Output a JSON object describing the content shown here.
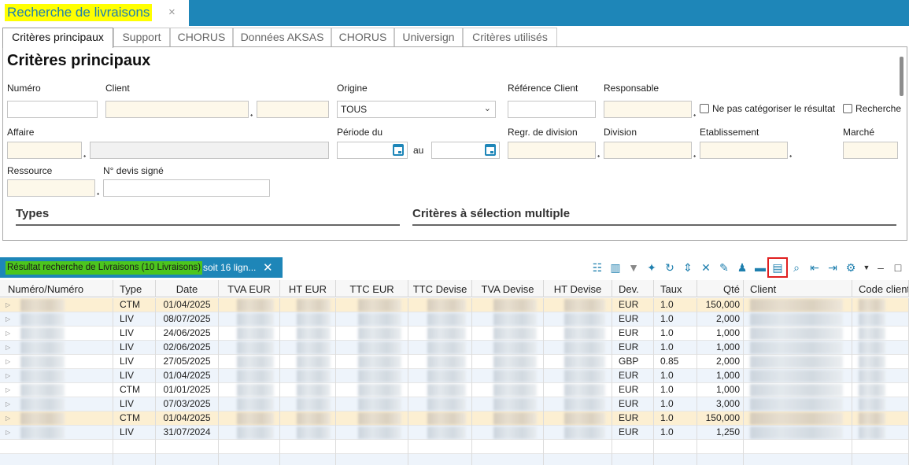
{
  "window": {
    "title": "Recherche de livraisons",
    "close_glyph": "×"
  },
  "tabs": [
    "Critères principaux",
    "Support",
    "CHORUS",
    "Données AKSAS",
    "CHORUS",
    "Universign",
    "Critères utilisés"
  ],
  "form": {
    "heading": "Critères principaux",
    "labels": {
      "numero": "Numéro",
      "client": "Client",
      "origine": "Origine",
      "ref_client": "Référence Client",
      "responsable": "Responsable",
      "affaire": "Affaire",
      "periode_du": "Période du",
      "au": "au",
      "regr_division": "Regr. de division",
      "division": "Division",
      "etablissement": "Etablissement",
      "marche": "Marché",
      "ressource": "Ressource",
      "devis_signe": "N° devis signé"
    },
    "origine_value": "TOUS",
    "checkbox_ne_pas_categoriser": "Ne pas catégoriser le résultat",
    "checkbox_recherche": "Recherche",
    "section_types": "Types",
    "section_multi": "Critères à sélection multiple"
  },
  "results": {
    "tab_label": "Résultat recherche de Livraisons (10 Livraisons)",
    "tab_suffix": "soit 16 lign...",
    "columns": [
      "Numéro/Numéro",
      "Type",
      "Date",
      "TVA EUR",
      "HT EUR",
      "TTC EUR",
      "TTC Devise",
      "TVA Devise",
      "HT Devise",
      "Dev.",
      "Taux",
      "Qté",
      "Client",
      "Code client"
    ],
    "rows": [
      {
        "type": "CTM",
        "date": "01/04/2025",
        "dev": "EUR",
        "taux": "1.0",
        "qte": "150,000",
        "highlight": true
      },
      {
        "type": "LIV",
        "date": "08/07/2025",
        "dev": "EUR",
        "taux": "1.0",
        "qte": "2,000",
        "highlight": false
      },
      {
        "type": "LIV",
        "date": "24/06/2025",
        "dev": "EUR",
        "taux": "1.0",
        "qte": "1,000",
        "highlight": false
      },
      {
        "type": "LIV",
        "date": "02/06/2025",
        "dev": "EUR",
        "taux": "1.0",
        "qte": "1,000",
        "highlight": false
      },
      {
        "type": "LIV",
        "date": "27/05/2025",
        "dev": "GBP",
        "taux": "0.85",
        "qte": "2,000",
        "highlight": false
      },
      {
        "type": "LIV",
        "date": "01/04/2025",
        "dev": "EUR",
        "taux": "1.0",
        "qte": "1,000",
        "highlight": false
      },
      {
        "type": "CTM",
        "date": "01/01/2025",
        "dev": "EUR",
        "taux": "1.0",
        "qte": "1,000",
        "highlight": false
      },
      {
        "type": "LIV",
        "date": "07/03/2025",
        "dev": "EUR",
        "taux": "1.0",
        "qte": "3,000",
        "highlight": false
      },
      {
        "type": "CTM",
        "date": "01/04/2025",
        "dev": "EUR",
        "taux": "1.0",
        "qte": "150,000",
        "highlight": true
      },
      {
        "type": "LIV",
        "date": "31/07/2024",
        "dev": "EUR",
        "taux": "1.0",
        "qte": "1,250",
        "highlight": false
      }
    ]
  },
  "toolbar_icons": [
    "columns-icon",
    "bar-chart-icon",
    "filter-icon",
    "pin-icon",
    "refresh-icon",
    "expand-icon",
    "collapse-icon",
    "pipette-icon",
    "group-icon",
    "stack-icon",
    "document-icon",
    "search-icon",
    "indent-decrease-icon",
    "indent-increase-icon",
    "search-settings-icon",
    "dropdown-arrow-icon",
    "minimize-icon",
    "maximize-icon"
  ],
  "colors": {
    "accent": "#1e86b8",
    "title_highlight": "#ffff00",
    "result_highlight": "#4cc61e",
    "row_highlight": "#fcefd2",
    "row_alt": "#eef4fb"
  }
}
